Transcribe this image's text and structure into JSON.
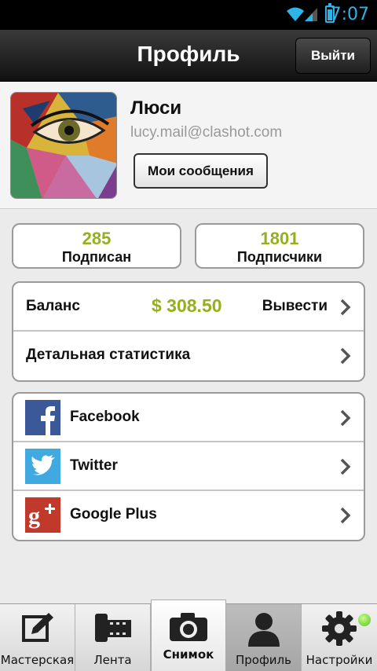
{
  "status_bar": {
    "time": "7:07"
  },
  "header": {
    "title": "Профиль",
    "logout_label": "Выйти"
  },
  "profile": {
    "name": "Люси",
    "email": "lucy.mail@clashot.com",
    "messages_button": "Мои сообщения"
  },
  "stats": {
    "following": {
      "count": "285",
      "label": "Подписан"
    },
    "followers": {
      "count": "1801",
      "label": "Подписчики"
    }
  },
  "account": {
    "balance_label": "Баланс",
    "balance_value": "$ 308.50",
    "withdraw_label": "Вывести",
    "stats_label": "Детальная статистика"
  },
  "social": [
    {
      "label": "Facebook",
      "icon": "facebook-icon"
    },
    {
      "label": "Twitter",
      "icon": "twitter-icon"
    },
    {
      "label": "Google Plus",
      "icon": "google-plus-icon"
    }
  ],
  "tabs": [
    {
      "label": "Мастерская",
      "icon": "edit-icon"
    },
    {
      "label": "Лента",
      "icon": "film-icon"
    },
    {
      "label": "Снимок",
      "icon": "camera-icon"
    },
    {
      "label": "Профиль",
      "icon": "user-icon"
    },
    {
      "label": "Настройки",
      "icon": "gear-icon"
    }
  ],
  "colors": {
    "accent_green": "#94b11b",
    "status_blue": "#2fb4e8",
    "facebook_blue": "#3b5998",
    "twitter_blue": "#3fa9e0",
    "google_red": "#c1392b"
  }
}
